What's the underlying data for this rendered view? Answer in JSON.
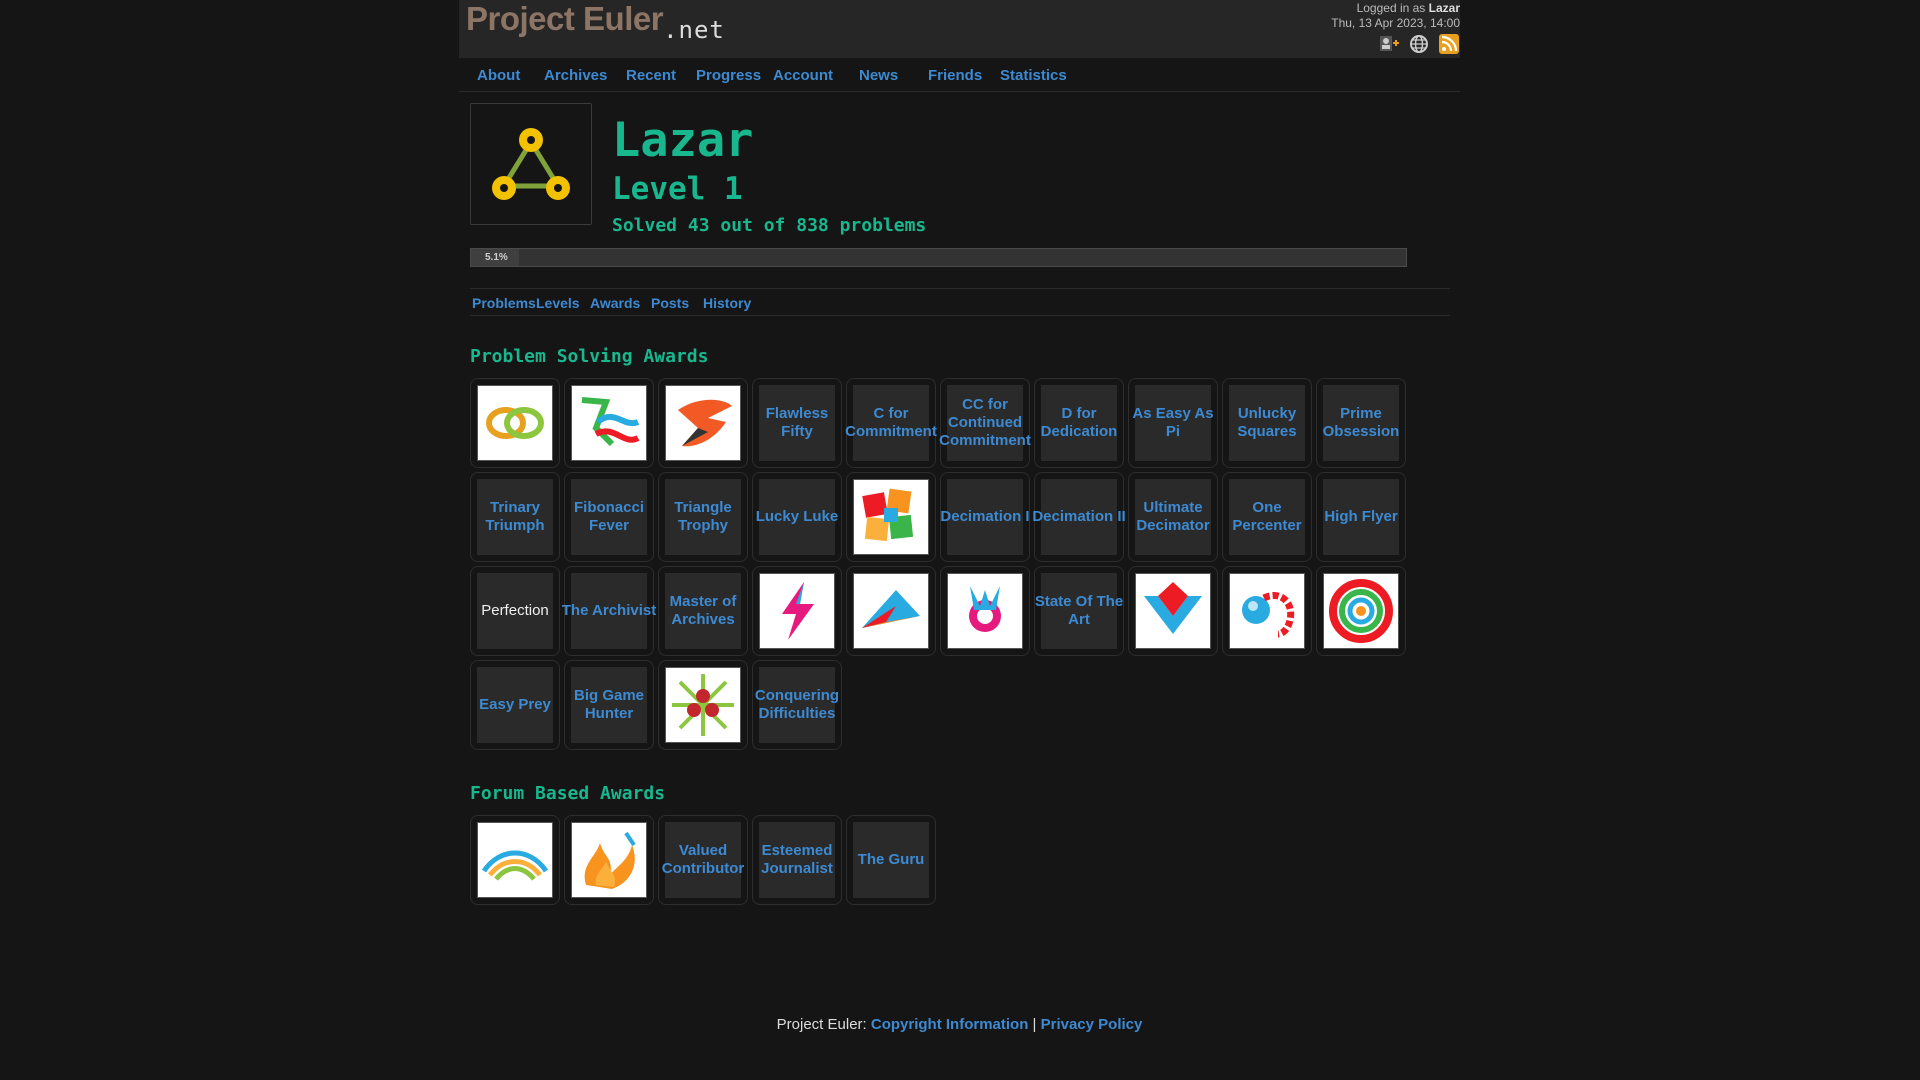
{
  "header": {
    "logo_main": "Project Euler",
    "logo_suffix": ".net",
    "logged_in_prefix": "Logged in as ",
    "user": "Lazar",
    "datetime": "Thu, 13 Apr 2023, 14:00",
    "icons": [
      "add-friend-icon",
      "globe-icon",
      "rss-icon"
    ]
  },
  "nav": [
    "About",
    "Archives",
    "Recent",
    "Progress",
    "Account",
    "News",
    "Friends",
    "Statistics"
  ],
  "profile": {
    "name": "Lazar",
    "level": "Level 1",
    "solved": "Solved 43 out of 838 problems",
    "progress_percent": 5.1,
    "progress_label": "5.1%"
  },
  "subnav": [
    "Problems",
    "Levels",
    "Awards",
    "Posts",
    "History"
  ],
  "problem_awards": {
    "title": "Problem Solving Awards",
    "items": [
      {
        "type": "image",
        "icon": "linked-rings-award-icon"
      },
      {
        "type": "image",
        "icon": "ribbons-award-icon"
      },
      {
        "type": "image",
        "icon": "swoosh-award-icon"
      },
      {
        "type": "text",
        "label": "Flawless Fifty"
      },
      {
        "type": "text",
        "label": "C for Commitment"
      },
      {
        "type": "text",
        "label": "CC for Continued Commitment"
      },
      {
        "type": "text",
        "label": "D for Dedication"
      },
      {
        "type": "text",
        "label": "As Easy As Pi"
      },
      {
        "type": "text",
        "label": "Unlucky Squares"
      },
      {
        "type": "text",
        "label": "Prime Obsession"
      },
      {
        "type": "text",
        "label": "Trinary Triumph"
      },
      {
        "type": "text",
        "label": "Fibonacci Fever"
      },
      {
        "type": "text",
        "label": "Triangle Trophy"
      },
      {
        "type": "text",
        "label": "Lucky Luke"
      },
      {
        "type": "image",
        "icon": "patchwork-award-icon"
      },
      {
        "type": "text",
        "label": "Decimation I"
      },
      {
        "type": "text",
        "label": "Decimation II"
      },
      {
        "type": "text",
        "label": "Ultimate Decimator"
      },
      {
        "type": "text",
        "label": "One Percenter"
      },
      {
        "type": "text",
        "label": "High Flyer"
      },
      {
        "type": "plain",
        "label": "Perfection"
      },
      {
        "type": "text",
        "label": "The Archivist"
      },
      {
        "type": "text",
        "label": "Master of Archives"
      },
      {
        "type": "image",
        "icon": "lightning-award-icon"
      },
      {
        "type": "image",
        "icon": "arrow-award-icon"
      },
      {
        "type": "image",
        "icon": "flower-award-icon"
      },
      {
        "type": "text",
        "label": "State Of The Art"
      },
      {
        "type": "image",
        "icon": "chevron-award-icon"
      },
      {
        "type": "image",
        "icon": "globe-award-icon"
      },
      {
        "type": "image",
        "icon": "aperture-award-icon"
      },
      {
        "type": "text",
        "label": "Easy Prey"
      },
      {
        "type": "text",
        "label": "Big Game Hunter"
      },
      {
        "type": "image",
        "icon": "berries-award-icon"
      },
      {
        "type": "text",
        "label": "Conquering Difficulties"
      }
    ]
  },
  "forum_awards": {
    "title": "Forum Based Awards",
    "items": [
      {
        "type": "image",
        "icon": "rainbow-award-icon"
      },
      {
        "type": "image",
        "icon": "flame-award-icon"
      },
      {
        "type": "text",
        "label": "Valued Contributor"
      },
      {
        "type": "text",
        "label": "Esteemed Journalist"
      },
      {
        "type": "text",
        "label": "The Guru"
      }
    ]
  },
  "footer": {
    "prefix": "Project Euler: ",
    "copyright": "Copyright Information",
    "separator": " | ",
    "privacy": "Privacy Policy"
  }
}
